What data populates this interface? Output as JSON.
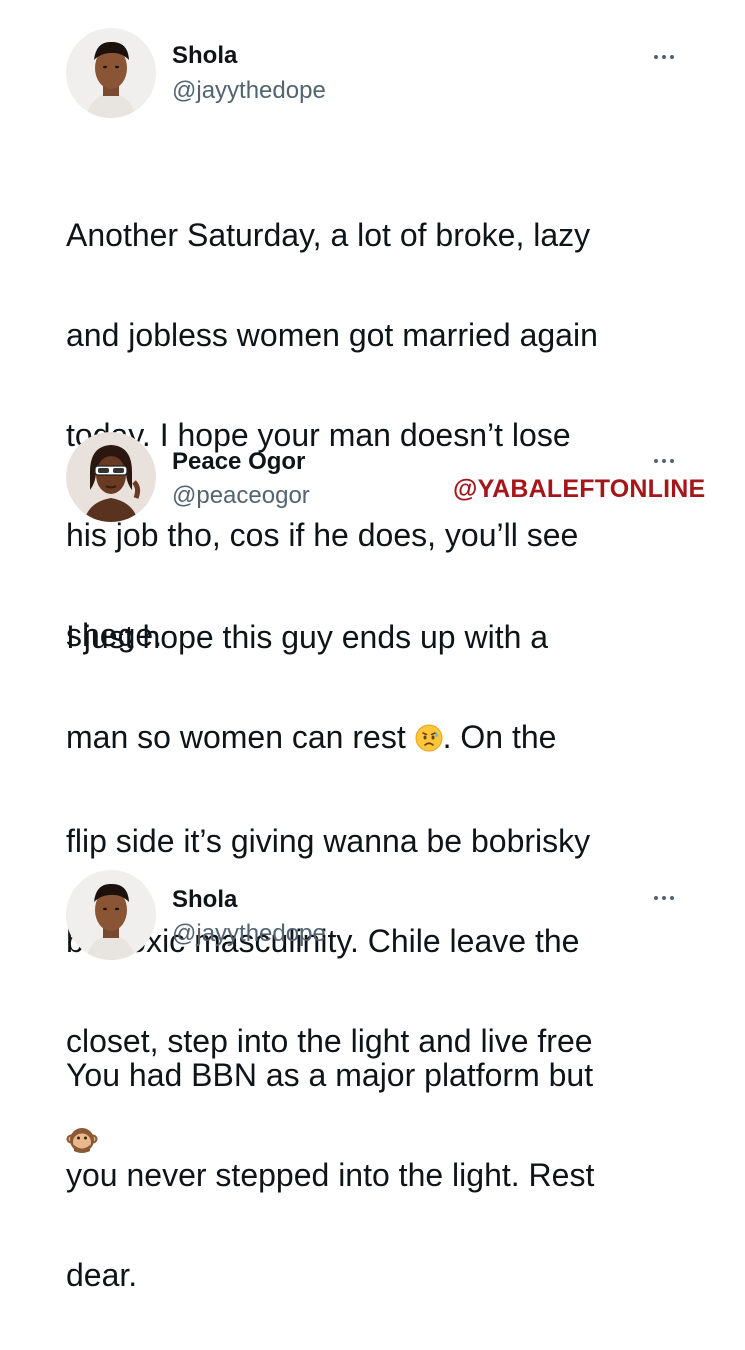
{
  "tweets": [
    {
      "name": "Shola",
      "handle": "@jayythedope",
      "lines": [
        "Another Saturday, a lot of broke, lazy",
        "and jobless women got married again",
        "today. I hope your man doesn’t lose",
        "his job tho, cos if he does, you’ll see",
        "shege."
      ]
    },
    {
      "name": "Peace Ogor",
      "handle": "@peaceogor",
      "lines": [
        "I just hope this guy ends up with a",
        "man so women can rest",
        ". On the",
        "flip side it’s giving wanna be bobrisky",
        "but toxic masculinity. Chile leave the",
        "closet, step into the light and live free"
      ],
      "emojis": [
        "sad-relieved-face",
        "speak-no-evil-monkey"
      ]
    },
    {
      "name": "Shola",
      "handle": "@jayythedope",
      "lines": [
        "You had BBN as a major platform but",
        "you never stepped into the light. Rest",
        "dear."
      ]
    }
  ],
  "watermark": "@YABALEFTONLINE",
  "icons": {
    "more": "more-options-icon"
  },
  "colors": {
    "text": "#0f1419",
    "secondary": "#536471",
    "watermark": "#a4161a"
  }
}
